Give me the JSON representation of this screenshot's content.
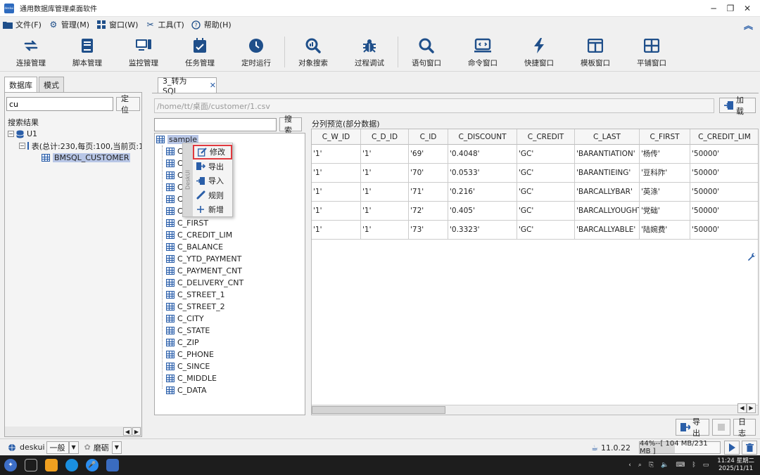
{
  "window": {
    "title": "通用数据库管理桌面软件",
    "logo_text": "deskui",
    "minimize": "−",
    "maximize": "❐",
    "close": "✕"
  },
  "menu": [
    {
      "label": "文件(F)",
      "icon": "folder-icon"
    },
    {
      "label": "管理(M)",
      "icon": "gear-icon"
    },
    {
      "label": "窗口(W)",
      "icon": "window-icon"
    },
    {
      "label": "工具(T)",
      "icon": "tools-icon"
    },
    {
      "label": "帮助(H)",
      "icon": "help-icon"
    }
  ],
  "toolbar": [
    {
      "label": "连接管理",
      "icon": "connect-icon"
    },
    {
      "label": "脚本管理",
      "icon": "script-icon"
    },
    {
      "label": "监控管理",
      "icon": "monitor-icon"
    },
    {
      "label": "任务管理",
      "icon": "task-icon"
    },
    {
      "label": "定时运行",
      "icon": "clock-icon"
    },
    {
      "label": "对象搜索",
      "icon": "object-search-icon"
    },
    {
      "label": "过程调试",
      "icon": "debug-icon"
    },
    {
      "label": "语句窗口",
      "icon": "search-icon"
    },
    {
      "label": "命令窗口",
      "icon": "command-icon"
    },
    {
      "label": "快捷窗口",
      "icon": "lightning-icon"
    },
    {
      "label": "模板窗口",
      "icon": "template-icon"
    },
    {
      "label": "平铺窗口",
      "icon": "tile-icon"
    }
  ],
  "left": {
    "tabs": [
      "数据库",
      "模式"
    ],
    "search_value": "cu",
    "locate_button": "定位",
    "results_label": "搜索结果",
    "tree": [
      {
        "label": "U1",
        "toggle": "−"
      },
      {
        "label": "表(总计:230,每页:100,当前页:1",
        "toggle": "−"
      },
      {
        "label": "BMSQL_CUSTOMER"
      }
    ]
  },
  "main": {
    "tab_label": "3_转为 SQL",
    "tab_close": "✕",
    "path": "/home/tt/桌面/customer/1.csv",
    "load_button": "加载",
    "search_button": "搜索",
    "preview_label": "分列预览(部分数据)",
    "root_label": "sample",
    "columns_tree": [
      "C_FIRST",
      "C_CREDIT_LIM",
      "C_BALANCE",
      "C_YTD_PAYMENT",
      "C_PAYMENT_CNT",
      "C_DELIVERY_CNT",
      "C_STREET_1",
      "C_STREET_2",
      "C_CITY",
      "C_STATE",
      "C_ZIP",
      "C_PHONE",
      "C_SINCE",
      "C_MIDDLE",
      "C_DATA"
    ],
    "hidden_rows_prefix": "C",
    "context_menu": {
      "brand": "DeskUI",
      "items": [
        {
          "label": "修改",
          "icon": "edit-icon"
        },
        {
          "label": "导出",
          "icon": "export-icon"
        },
        {
          "label": "导入",
          "icon": "import-icon"
        },
        {
          "label": "规则",
          "icon": "rule-icon"
        },
        {
          "label": "新增",
          "icon": "add-icon"
        }
      ]
    },
    "table": {
      "headers": [
        "C_W_ID",
        "C_D_ID",
        "C_ID",
        "C_DISCOUNT",
        "C_CREDIT",
        "C_LAST",
        "C_FIRST",
        "C_CREDIT_LIM"
      ],
      "rows": [
        [
          "'1'",
          "'1'",
          "'69'",
          "'0.4048'",
          "'GC'",
          "'BARANTIATION'",
          "'杨传'",
          "'50000'"
        ],
        [
          "'1'",
          "'1'",
          "'70'",
          "'0.0533'",
          "'GC'",
          "'BARANTIEING'",
          "'豆科阼'",
          "'50000'"
        ],
        [
          "'1'",
          "'1'",
          "'71'",
          "'0.216'",
          "'GC'",
          "'BARCALLYBAR'",
          "'英涤'",
          "'50000'"
        ],
        [
          "'1'",
          "'1'",
          "'72'",
          "'0.405'",
          "'GC'",
          "'BARCALLYOUGHT'",
          "'党础'",
          "'50000'"
        ],
        [
          "'1'",
          "'1'",
          "'73'",
          "'0.3323'",
          "'GC'",
          "'BARCALLYABLE'",
          "'陆婉费'",
          "'50000'"
        ]
      ]
    },
    "export_button": "导出",
    "log_button": "日志"
  },
  "status": {
    "user": "deskui",
    "mode": "一般",
    "theme": "磨砺",
    "version": "11.0.22",
    "memory": "44%--[ 104 MB/231 MB ]",
    "memory_fraction": 0.44
  },
  "taskbar": {
    "time": "11:24 星期二",
    "date": "2025/11/11"
  }
}
